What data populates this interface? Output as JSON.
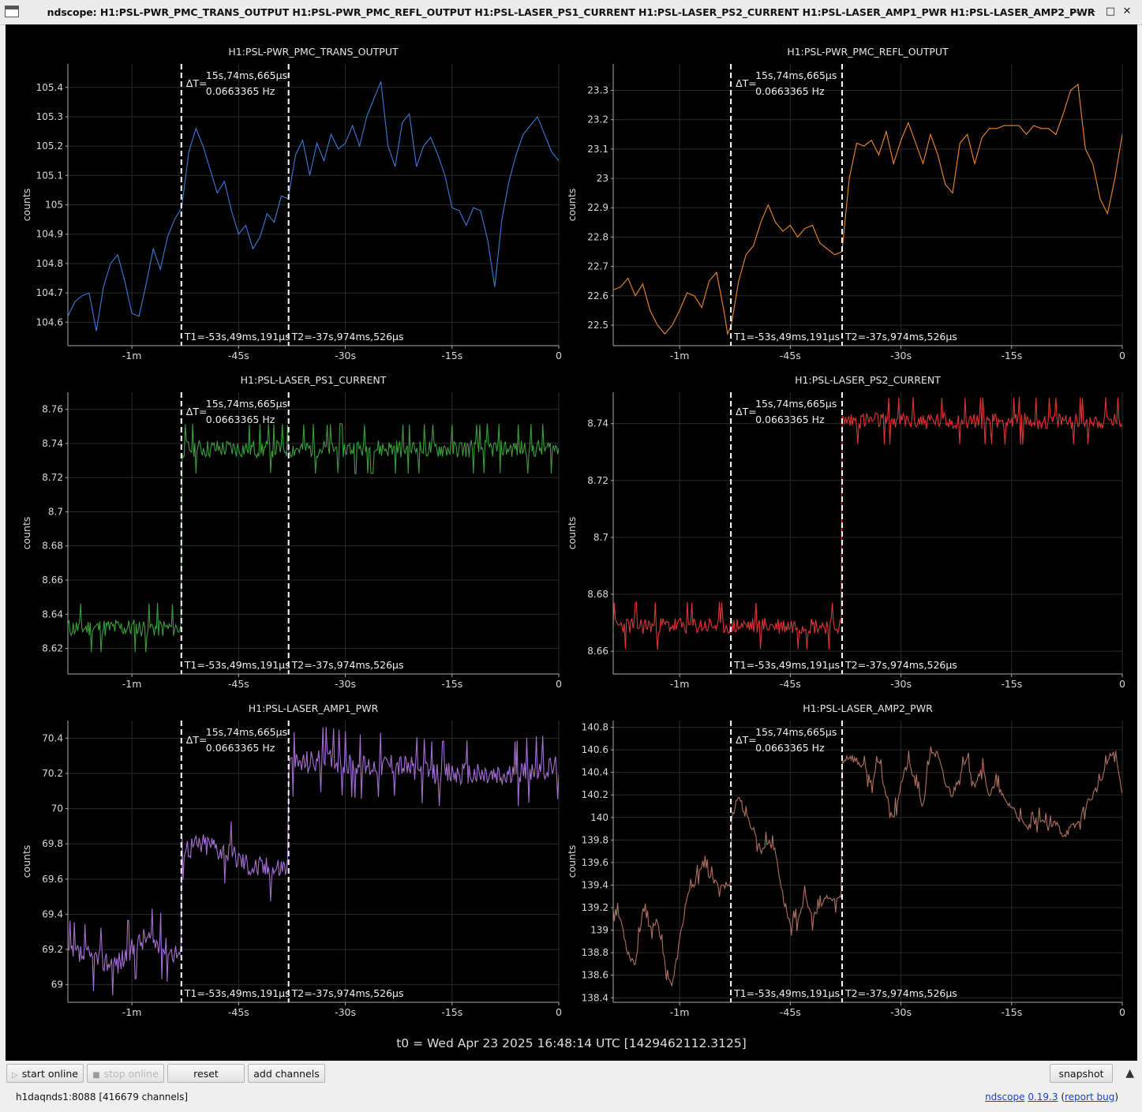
{
  "window": {
    "title": "ndscope: H1:PSL-PWR_PMC_TRANS_OUTPUT H1:PSL-PWR_PMC_REFL_OUTPUT H1:PSL-LASER_PS1_CURRENT H1:PSL-LASER_PS2_CURRENT H1:PSL-LASER_AMP1_PWR H1:PSL-LASER_AMP2_PWR",
    "minimize_icon": "chevron-up-icon",
    "buttons": [
      "minimize-icon",
      "maximize-icon",
      "close-icon"
    ]
  },
  "cursors": {
    "delta_label": "ΔT=",
    "delta_time": "15s,74ms,665μs",
    "delta_freq": "0.0663365 Hz",
    "t1_label": "T1=-53s,49ms,191μs",
    "t2_label": "T2=-37s,974ms,526μs",
    "t1": -53.049,
    "t2": -37.975
  },
  "t0_label": "t0 = Wed Apr 23 2025 16:48:14 UTC [1429462112.3125]",
  "toolbar": {
    "start_online": "start online",
    "stop_online": "stop online",
    "reset": "reset",
    "add_channels": "add channels",
    "snapshot": "snapshot"
  },
  "status": {
    "server": "h1daqnds1:8088  [416679 channels]",
    "app_link": "ndscope",
    "version": "0.19.3",
    "report_bug": "report bug"
  },
  "chart_data": [
    {
      "type": "line",
      "title": "H1:PSL-PWR_PMC_TRANS_OUTPUT",
      "ylabel": "counts",
      "color": "#3b7bd6",
      "xlim": [
        -69,
        0
      ],
      "ylim": [
        104.52,
        105.48
      ],
      "yticks": [
        104.6,
        104.7,
        104.8,
        104.9,
        105,
        105.1,
        105.2,
        105.3,
        105.4
      ],
      "ytick_labels": [
        "104.6",
        "104.7",
        "104.8",
        "104.9",
        "105",
        "105.1",
        "105.2",
        "105.3",
        "105.4"
      ],
      "xticks": [
        -60,
        -45,
        -30,
        -15,
        0
      ],
      "xtick_labels": [
        "-1m",
        "-45s",
        "-30s",
        "-15s",
        "0"
      ],
      "points": [
        [
          -69,
          104.62
        ],
        [
          -68,
          104.67
        ],
        [
          -67,
          104.69
        ],
        [
          -66,
          104.7
        ],
        [
          -65,
          104.57
        ],
        [
          -64,
          104.72
        ],
        [
          -63,
          104.8
        ],
        [
          -62,
          104.83
        ],
        [
          -61,
          104.74
        ],
        [
          -60,
          104.63
        ],
        [
          -59,
          104.62
        ],
        [
          -58,
          104.73
        ],
        [
          -57,
          104.85
        ],
        [
          -56,
          104.78
        ],
        [
          -55,
          104.89
        ],
        [
          -54,
          104.95
        ],
        [
          -53,
          104.99
        ],
        [
          -52,
          105.18
        ],
        [
          -51,
          105.26
        ],
        [
          -50,
          105.2
        ],
        [
          -49,
          105.12
        ],
        [
          -48,
          105.04
        ],
        [
          -47,
          105.08
        ],
        [
          -46,
          104.98
        ],
        [
          -45,
          104.9
        ],
        [
          -44,
          104.93
        ],
        [
          -43,
          104.85
        ],
        [
          -42,
          104.89
        ],
        [
          -41,
          104.97
        ],
        [
          -40,
          104.94
        ],
        [
          -39,
          105.03
        ],
        [
          -38.0,
          105.02
        ],
        [
          -37.5,
          105.1
        ],
        [
          -37,
          105.17
        ],
        [
          -36,
          105.22
        ],
        [
          -35,
          105.1
        ],
        [
          -34,
          105.21
        ],
        [
          -33,
          105.15
        ],
        [
          -32,
          105.24
        ],
        [
          -31,
          105.19
        ],
        [
          -30,
          105.21
        ],
        [
          -29,
          105.27
        ],
        [
          -28,
          105.2
        ],
        [
          -27,
          105.3
        ],
        [
          -26,
          105.36
        ],
        [
          -25,
          105.42
        ],
        [
          -24,
          105.2
        ],
        [
          -23,
          105.13
        ],
        [
          -22,
          105.28
        ],
        [
          -21,
          105.31
        ],
        [
          -20,
          105.13
        ],
        [
          -19,
          105.2
        ],
        [
          -18,
          105.23
        ],
        [
          -17,
          105.17
        ],
        [
          -16,
          105.1
        ],
        [
          -15,
          104.99
        ],
        [
          -14,
          104.98
        ],
        [
          -13,
          104.93
        ],
        [
          -12,
          104.99
        ],
        [
          -11,
          104.98
        ],
        [
          -10,
          104.88
        ],
        [
          -9,
          104.72
        ],
        [
          -8,
          104.95
        ],
        [
          -7,
          105.08
        ],
        [
          -6,
          105.17
        ],
        [
          -5,
          105.24
        ],
        [
          -4,
          105.27
        ],
        [
          -3,
          105.3
        ],
        [
          -2,
          105.24
        ],
        [
          -1,
          105.18
        ],
        [
          0,
          105.15
        ]
      ],
      "noise": 0
    },
    {
      "type": "line",
      "title": "H1:PSL-PWR_PMC_REFL_OUTPUT",
      "ylabel": "counts",
      "color": "#f0892a",
      "xlim": [
        -69,
        0
      ],
      "ylim": [
        22.43,
        23.39
      ],
      "yticks": [
        22.5,
        22.6,
        22.7,
        22.8,
        22.9,
        23,
        23.1,
        23.2,
        23.3
      ],
      "ytick_labels": [
        "22.5",
        "22.6",
        "22.7",
        "22.8",
        "22.9",
        "23",
        "23.1",
        "23.2",
        "23.3"
      ],
      "xticks": [
        -60,
        -45,
        -30,
        -15,
        0
      ],
      "xtick_labels": [
        "-1m",
        "-45s",
        "-30s",
        "-15s",
        "0"
      ],
      "points": [
        [
          -69,
          22.62
        ],
        [
          -68,
          22.63
        ],
        [
          -67,
          22.66
        ],
        [
          -66,
          22.6
        ],
        [
          -65,
          22.64
        ],
        [
          -64,
          22.55
        ],
        [
          -63,
          22.5
        ],
        [
          -62,
          22.47
        ],
        [
          -61,
          22.5
        ],
        [
          -60,
          22.55
        ],
        [
          -59,
          22.61
        ],
        [
          -58,
          22.6
        ],
        [
          -57,
          22.56
        ],
        [
          -56,
          22.65
        ],
        [
          -55,
          22.68
        ],
        [
          -54,
          22.55
        ],
        [
          -53.5,
          22.47
        ],
        [
          -53,
          22.5
        ],
        [
          -52,
          22.65
        ],
        [
          -51,
          22.74
        ],
        [
          -50,
          22.77
        ],
        [
          -49,
          22.85
        ],
        [
          -48,
          22.91
        ],
        [
          -47,
          22.85
        ],
        [
          -46,
          22.82
        ],
        [
          -45,
          22.84
        ],
        [
          -44,
          22.8
        ],
        [
          -43,
          22.83
        ],
        [
          -42,
          22.84
        ],
        [
          -41,
          22.78
        ],
        [
          -40,
          22.76
        ],
        [
          -39,
          22.74
        ],
        [
          -38,
          22.75
        ],
        [
          -37,
          23.0
        ],
        [
          -36,
          23.12
        ],
        [
          -35,
          23.11
        ],
        [
          -34,
          23.13
        ],
        [
          -33,
          23.08
        ],
        [
          -32,
          23.16
        ],
        [
          -31,
          23.05
        ],
        [
          -30,
          23.13
        ],
        [
          -29,
          23.19
        ],
        [
          -28,
          23.12
        ],
        [
          -27,
          23.05
        ],
        [
          -26,
          23.15
        ],
        [
          -25,
          23.08
        ],
        [
          -24,
          22.98
        ],
        [
          -23,
          22.95
        ],
        [
          -22,
          23.12
        ],
        [
          -21,
          23.15
        ],
        [
          -20,
          23.05
        ],
        [
          -19,
          23.14
        ],
        [
          -18,
          23.17
        ],
        [
          -17,
          23.17
        ],
        [
          -16,
          23.18
        ],
        [
          -15,
          23.18
        ],
        [
          -14,
          23.18
        ],
        [
          -13,
          23.15
        ],
        [
          -12,
          23.18
        ],
        [
          -11,
          23.17
        ],
        [
          -10,
          23.17
        ],
        [
          -9,
          23.15
        ],
        [
          -8,
          23.22
        ],
        [
          -7,
          23.3
        ],
        [
          -6,
          23.32
        ],
        [
          -5,
          23.1
        ],
        [
          -4,
          23.05
        ],
        [
          -3,
          22.93
        ],
        [
          -2,
          22.88
        ],
        [
          -1,
          23.0
        ],
        [
          0,
          23.15
        ]
      ],
      "noise": 0
    },
    {
      "type": "line",
      "title": "H1:PSL-LASER_PS1_CURRENT",
      "ylabel": "counts",
      "color": "#3a9e3a",
      "xlim": [
        -69,
        0
      ],
      "ylim": [
        8.605,
        8.77
      ],
      "yticks": [
        8.62,
        8.64,
        8.66,
        8.68,
        8.7,
        8.72,
        8.74,
        8.76
      ],
      "ytick_labels": [
        "8.62",
        "8.64",
        "8.66",
        "8.68",
        "8.7",
        "8.72",
        "8.74",
        "8.76"
      ],
      "xticks": [
        -60,
        -45,
        -30,
        -15,
        0
      ],
      "xtick_labels": [
        "-1m",
        "-45s",
        "-30s",
        "-15s",
        "0"
      ],
      "points": [
        [
          -69,
          8.632
        ],
        [
          -53.1,
          8.632
        ],
        [
          -53.0,
          8.737
        ],
        [
          0,
          8.737
        ]
      ],
      "noise": 0.007,
      "seed": 11
    },
    {
      "type": "line",
      "title": "H1:PSL-LASER_PS2_CURRENT",
      "ylabel": "counts",
      "color": "#e03434",
      "xlim": [
        -69,
        0
      ],
      "ylim": [
        8.652,
        8.751
      ],
      "yticks": [
        8.66,
        8.68,
        8.7,
        8.72,
        8.74
      ],
      "ytick_labels": [
        "8.66",
        "8.68",
        "8.7",
        "8.72",
        "8.74"
      ],
      "xticks": [
        -60,
        -45,
        -30,
        -15,
        0
      ],
      "xtick_labels": [
        "-1m",
        "-45s",
        "-30s",
        "-15s",
        "0"
      ],
      "points": [
        [
          -69,
          8.669
        ],
        [
          -38.1,
          8.669
        ],
        [
          -38.0,
          8.741
        ],
        [
          0,
          8.741
        ]
      ],
      "noise": 0.004,
      "seed": 23
    },
    {
      "type": "line",
      "title": "H1:PSL-LASER_AMP1_PWR",
      "ylabel": "counts",
      "color": "#a66fd3",
      "xlim": [
        -69,
        0
      ],
      "ylim": [
        68.9,
        70.5
      ],
      "yticks": [
        69,
        69.2,
        69.4,
        69.6,
        69.8,
        70,
        70.2,
        70.4
      ],
      "ytick_labels": [
        "69",
        "69.2",
        "69.4",
        "69.6",
        "69.8",
        "70",
        "70.2",
        "70.4"
      ],
      "xticks": [
        -60,
        -45,
        -30,
        -15,
        0
      ],
      "xtick_labels": [
        "-1m",
        "-45s",
        "-30s",
        "-15s",
        "0"
      ],
      "points": [
        [
          -69,
          69.18
        ],
        [
          -62,
          69.12
        ],
        [
          -60,
          69.2
        ],
        [
          -58,
          69.27
        ],
        [
          -55,
          69.2
        ],
        [
          -53.1,
          69.18
        ],
        [
          -53.0,
          69.78
        ],
        [
          -49,
          69.8
        ],
        [
          -46,
          69.74
        ],
        [
          -43,
          69.67
        ],
        [
          -40,
          69.66
        ],
        [
          -38.1,
          69.68
        ],
        [
          -38.0,
          70.25
        ],
        [
          -33,
          70.28
        ],
        [
          -28,
          70.24
        ],
        [
          -23,
          70.26
        ],
        [
          -18,
          70.2
        ],
        [
          -13,
          70.2
        ],
        [
          -8,
          70.18
        ],
        [
          -4,
          70.22
        ],
        [
          0,
          70.24
        ]
      ],
      "noise": 0.09,
      "seed": 37
    },
    {
      "type": "line",
      "title": "H1:PSL-LASER_AMP2_PWR",
      "ylabel": "counts",
      "color": "#b07060",
      "xlim": [
        -69,
        0
      ],
      "ylim": [
        138.36,
        140.86
      ],
      "yticks": [
        138.4,
        138.6,
        138.8,
        139,
        139.2,
        139.4,
        139.6,
        139.8,
        140,
        140.2,
        140.4,
        140.6,
        140.8
      ],
      "ytick_labels": [
        "138.4",
        "138.6",
        "138.8",
        "139",
        "139.2",
        "139.4",
        "139.6",
        "139.8",
        "140",
        "140.2",
        "140.4",
        "140.6",
        "140.8"
      ],
      "xticks": [
        -60,
        -45,
        -30,
        -15,
        0
      ],
      "xtick_labels": [
        "-1m",
        "-45s",
        "-30s",
        "-15s",
        "0"
      ],
      "points": [
        [
          -69,
          139.2
        ],
        [
          -68,
          139.1
        ],
        [
          -67,
          138.8
        ],
        [
          -66,
          138.7
        ],
        [
          -65,
          139.2
        ],
        [
          -64,
          139.0
        ],
        [
          -63,
          139.1
        ],
        [
          -62,
          138.7
        ],
        [
          -61,
          138.5
        ],
        [
          -60,
          138.9
        ],
        [
          -59,
          139.3
        ],
        [
          -58,
          139.4
        ],
        [
          -57,
          139.6
        ],
        [
          -56,
          139.5
        ],
        [
          -55,
          139.4
        ],
        [
          -54,
          139.4
        ],
        [
          -53.1,
          139.4
        ],
        [
          -53,
          140.0
        ],
        [
          -52,
          140.2
        ],
        [
          -51,
          140.0
        ],
        [
          -50,
          139.9
        ],
        [
          -49,
          139.7
        ],
        [
          -48,
          139.8
        ],
        [
          -47,
          139.7
        ],
        [
          -46,
          139.3
        ],
        [
          -45,
          139.05
        ],
        [
          -44,
          139.1
        ],
        [
          -43,
          139.3
        ],
        [
          -42,
          139.1
        ],
        [
          -41,
          139.2
        ],
        [
          -40,
          139.3
        ],
        [
          -39,
          139.25
        ],
        [
          -38.1,
          139.3
        ],
        [
          -38,
          140.5
        ],
        [
          -37,
          140.55
        ],
        [
          -36,
          140.5
        ],
        [
          -35,
          140.45
        ],
        [
          -34,
          140.3
        ],
        [
          -33,
          140.5
        ],
        [
          -32,
          140.2
        ],
        [
          -31,
          140.0
        ],
        [
          -30,
          140.3
        ],
        [
          -29,
          140.5
        ],
        [
          -28,
          140.3
        ],
        [
          -27,
          140.1
        ],
        [
          -26,
          140.6
        ],
        [
          -25,
          140.55
        ],
        [
          -24,
          140.3
        ],
        [
          -23,
          140.2
        ],
        [
          -22,
          140.4
        ],
        [
          -21,
          140.5
        ],
        [
          -20,
          140.3
        ],
        [
          -19,
          140.45
        ],
        [
          -18,
          140.2
        ],
        [
          -17,
          140.3
        ],
        [
          -16,
          140.15
        ],
        [
          -15,
          140.1
        ],
        [
          -14,
          140.0
        ],
        [
          -13,
          139.9
        ],
        [
          -12,
          139.95
        ],
        [
          -11,
          140.0
        ],
        [
          -10,
          139.9
        ],
        [
          -9,
          139.95
        ],
        [
          -8,
          139.85
        ],
        [
          -7,
          139.9
        ],
        [
          -6,
          139.95
        ],
        [
          -5,
          140.1
        ],
        [
          -4,
          140.2
        ],
        [
          -3,
          140.3
        ],
        [
          -2,
          140.5
        ],
        [
          -1,
          140.6
        ],
        [
          0,
          140.2
        ]
      ],
      "noise": 0.05,
      "seed": 53
    }
  ]
}
